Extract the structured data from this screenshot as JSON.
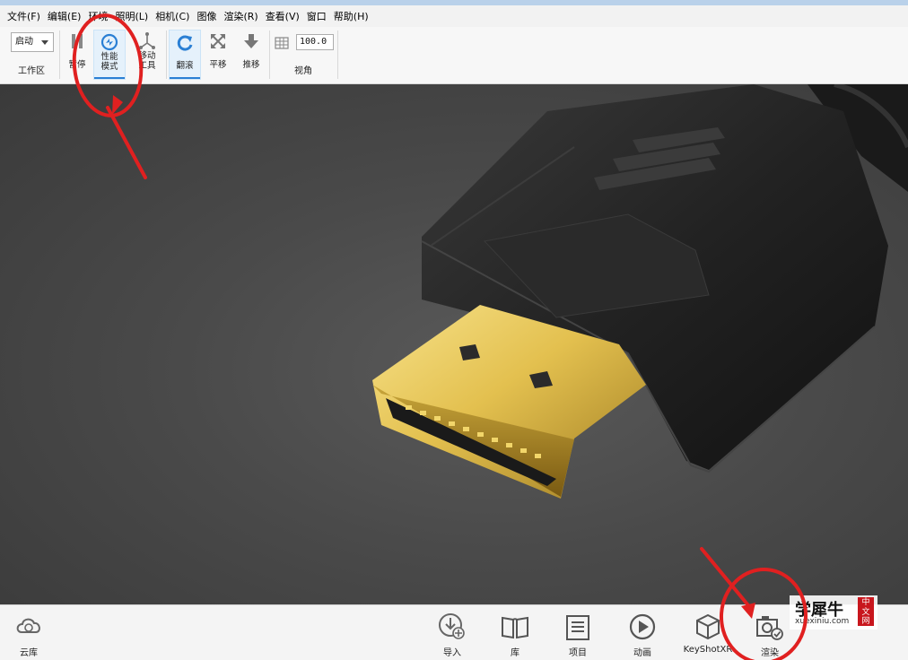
{
  "menubar": {
    "items": [
      "文件(F)",
      "编辑(E)",
      "环境",
      "照明(L)",
      "相机(C)",
      "图像",
      "渲染(R)",
      "查看(V)",
      "窗口",
      "帮助(H)"
    ]
  },
  "ribbon": {
    "workspace_select": "启动",
    "workspace_label": "工作区",
    "tools": {
      "pause": "暂停",
      "performance_1": "性能",
      "performance_2": "模式",
      "move_1": "移动",
      "move_2": "工具",
      "tumble": "翻滚",
      "pan": "平移",
      "dolly": "推移"
    },
    "fov_value": "100.0",
    "view_label": "视角"
  },
  "dock": {
    "cloud": "云库",
    "import": "导入",
    "library": "库",
    "project": "项目",
    "animation": "动画",
    "keyshotxr": "KeyShotXR",
    "render": "渲染"
  },
  "watermark": {
    "main": "学犀牛",
    "sub": "xuexiniu.com",
    "badge": "中文网"
  },
  "colors": {
    "accent": "#2a7fd4",
    "annotation": "#e02020",
    "viewport_bg": "#4a4a4a",
    "connector_gold": "#d9b548"
  }
}
